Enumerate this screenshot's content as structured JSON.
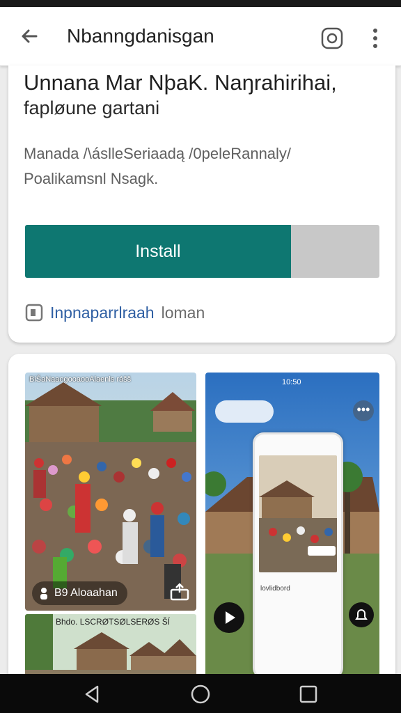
{
  "app_bar": {
    "title": "Nbanngdanisgan",
    "back_icon": "arrow-left-icon",
    "share_icon": "share-icon",
    "more_icon": "more-vert-icon"
  },
  "listing": {
    "app_name": "Unnana Mar NþaK. Naŋrahirihai,",
    "subtitle": "fapløune gartani",
    "description_line1": "Manada /\\áslleSeriaadą /0peleRannaly/",
    "description_line2": "Poalikamsnl Nsagk.",
    "install_label": "Install",
    "install_progress": 0.75,
    "info_link": "Inpnaparrlraah",
    "info_rest": "loman"
  },
  "screenshots": {
    "shot1_caption": "BiŠaNaaogooaooAlaenls rášš",
    "shot1_badge": "B9 Aloaahan",
    "shot2_caption": "Bhdo.   LSCRØTSØLSERØS ŠÍ",
    "shot3_time": "10:50",
    "shot3_phone_caption": "lovlidbord"
  },
  "colors": {
    "install_green": "#0e7771",
    "link_blue": "#2f5fa3"
  },
  "nav": {
    "back": "nav-back-icon",
    "home": "nav-home-icon",
    "recents": "nav-recents-icon"
  }
}
